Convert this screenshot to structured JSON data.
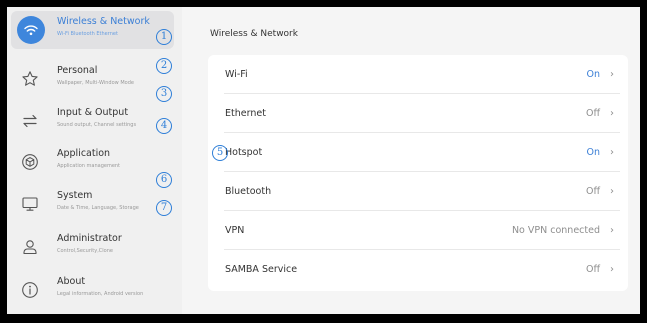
{
  "sidebar": {
    "items": [
      {
        "icon": "wifi-icon",
        "title": "Wireless & Network",
        "subtitle": "Wi-Fi Bluetooth Ethernet"
      },
      {
        "icon": "star-icon",
        "title": "Personal",
        "subtitle": "Wallpaper, Multi-Window Mode"
      },
      {
        "icon": "swap-arrows-icon",
        "title": "Input & Output",
        "subtitle": "Sound output, Channel settings"
      },
      {
        "icon": "cube-icon",
        "title": "Application",
        "subtitle": "Application management"
      },
      {
        "icon": "monitor-icon",
        "title": "System",
        "subtitle": "Date & Time, Language, Storage"
      },
      {
        "icon": "user-icon",
        "title": "Administrator",
        "subtitle": "Control,Security,Clone"
      },
      {
        "icon": "info-icon",
        "title": "About",
        "subtitle": "Legal information, Android version"
      }
    ]
  },
  "markers": [
    "1",
    "2",
    "3",
    "4",
    "5",
    "6",
    "7"
  ],
  "main": {
    "title": "Wireless & Network",
    "rows": [
      {
        "label": "Wi-Fi",
        "value": "On"
      },
      {
        "label": "Ethernet",
        "value": "Off"
      },
      {
        "label": "Hotspot",
        "value": "On"
      },
      {
        "label": "Bluetooth",
        "value": "Off"
      },
      {
        "label": "VPN",
        "value": "No VPN connected"
      },
      {
        "label": "SAMBA Service",
        "value": "Off"
      }
    ],
    "chevron": "›"
  },
  "colors": {
    "accent": "#3b7fd6",
    "marker": "#2f7fd8",
    "active_bg": "#e1e1e3"
  }
}
